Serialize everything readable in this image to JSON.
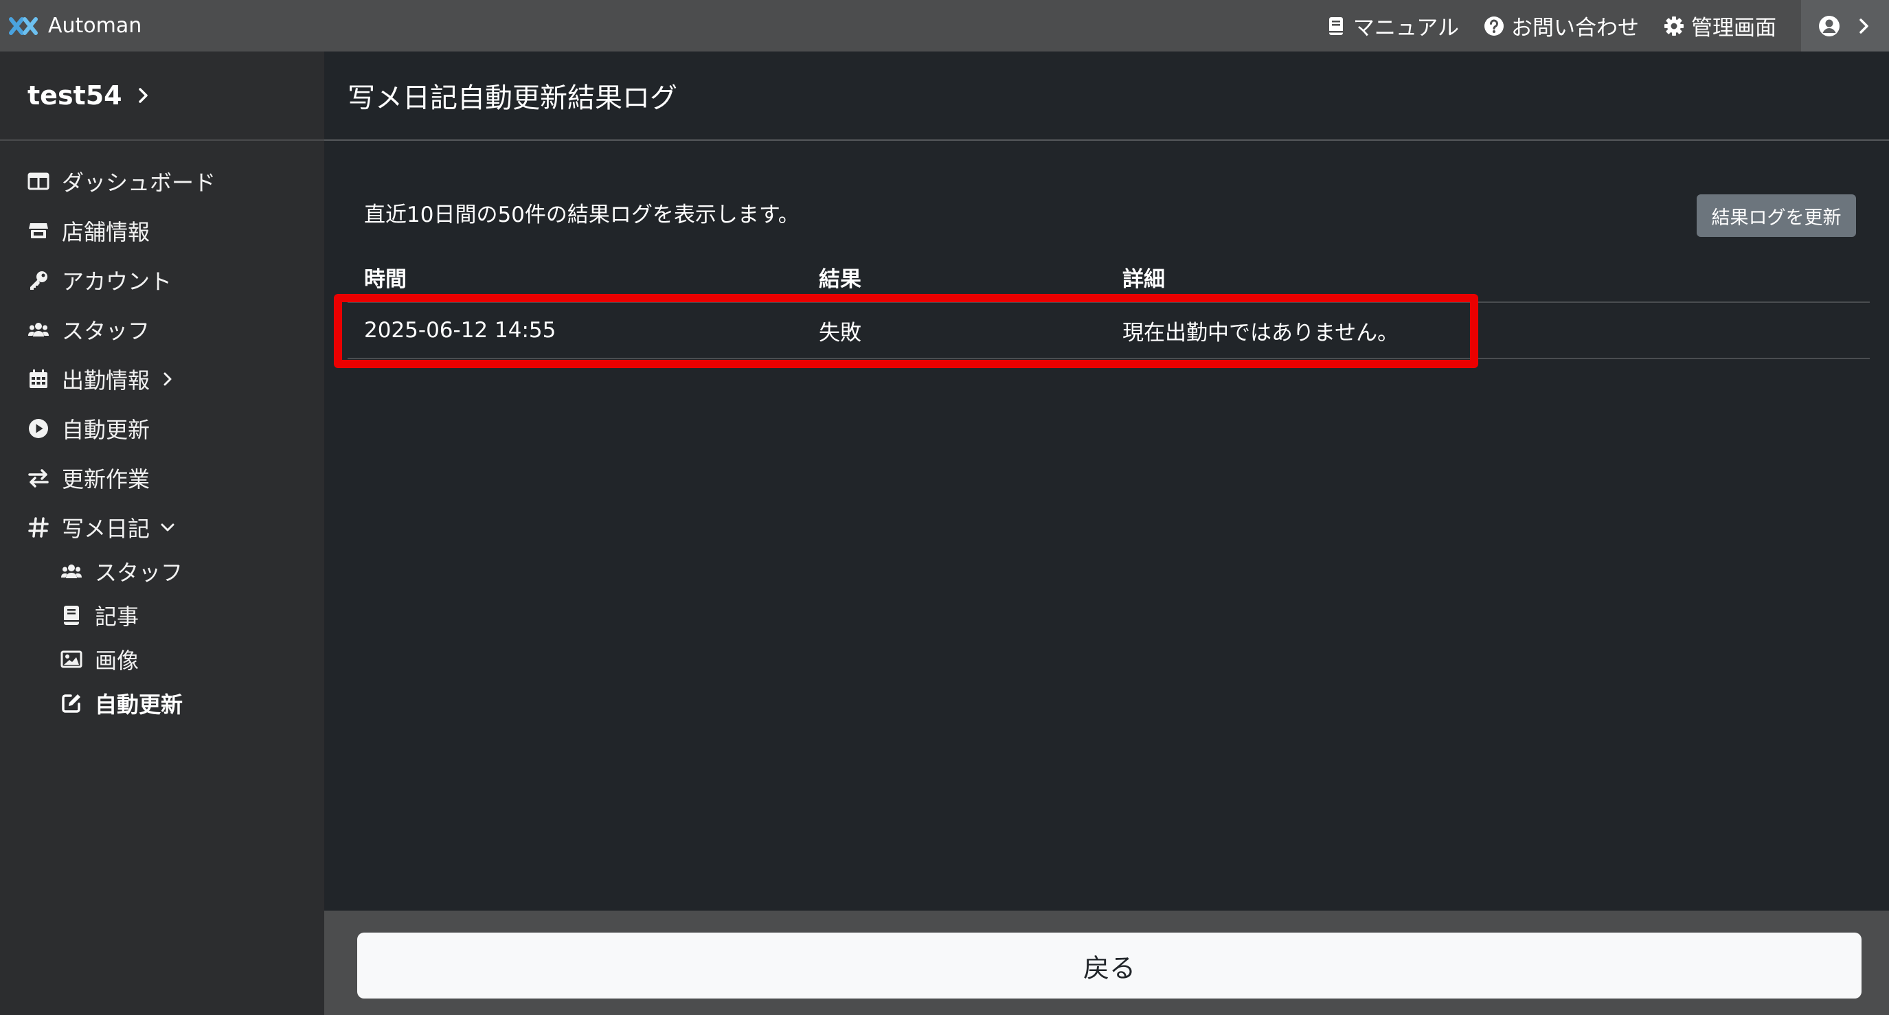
{
  "app": {
    "name": "Automan",
    "logo_icon": "automan-logo-icon"
  },
  "topbar": {
    "links": [
      {
        "label": "マニュアル",
        "icon": "book-icon"
      },
      {
        "label": "お問い合わせ",
        "icon": "question-circle-icon"
      },
      {
        "label": "管理画面",
        "icon": "gear-icon"
      }
    ],
    "user_icon": "user-circle-icon"
  },
  "sidebar": {
    "store_name": "test54",
    "items": [
      {
        "label": "ダッシュボード",
        "icon": "dashboard-icon"
      },
      {
        "label": "店舗情報",
        "icon": "store-icon"
      },
      {
        "label": "アカウント",
        "icon": "key-icon"
      },
      {
        "label": "スタッフ",
        "icon": "users-icon"
      },
      {
        "label": "出勤情報",
        "icon": "calendar-icon"
      },
      {
        "label": "自動更新",
        "icon": "play-circle-icon"
      },
      {
        "label": "更新作業",
        "icon": "exchange-icon"
      },
      {
        "label": "写メ日記",
        "icon": "hashtag-icon"
      }
    ],
    "subitems": [
      {
        "label": "スタッフ",
        "icon": "users-icon"
      },
      {
        "label": "記事",
        "icon": "book-icon"
      },
      {
        "label": "画像",
        "icon": "image-icon"
      },
      {
        "label": "自動更新",
        "icon": "edit-icon",
        "active": true
      }
    ]
  },
  "main": {
    "title": "写メ日記自動更新結果ログ",
    "description": "直近10日間の50件の結果ログを表示します。",
    "refresh_button": "結果ログを更新",
    "table": {
      "headers": [
        "時間",
        "結果",
        "詳細"
      ],
      "rows": [
        [
          "2025-06-12 14:55",
          "失敗",
          "現在出勤中ではありません。"
        ]
      ]
    },
    "highlight_color": "#ea0000"
  },
  "footer": {
    "back_button": "戻る"
  },
  "colors": {
    "topbar": "#4c4d4e",
    "sidebar": "#2c2d2f",
    "main": "#212529",
    "secondary_button": "#6c757d",
    "light_button": "#f8f9fa"
  }
}
